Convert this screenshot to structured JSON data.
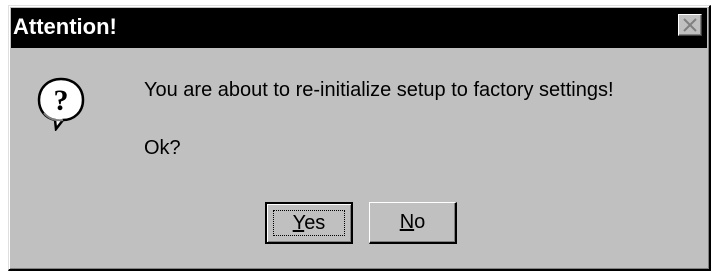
{
  "window": {
    "title": "Attention!",
    "close_icon": "close-icon"
  },
  "message": {
    "icon": "question-icon",
    "text": "You are about to re-initialize setup to factory settings!",
    "prompt": "Ok?"
  },
  "buttons": {
    "yes": {
      "mnemonic": "Y",
      "rest": "es",
      "default": true
    },
    "no": {
      "mnemonic": "N",
      "rest": "o",
      "default": false
    }
  },
  "colors": {
    "face": "#c0c0c0",
    "titlebar": "#000000",
    "title_text": "#ffffff"
  }
}
